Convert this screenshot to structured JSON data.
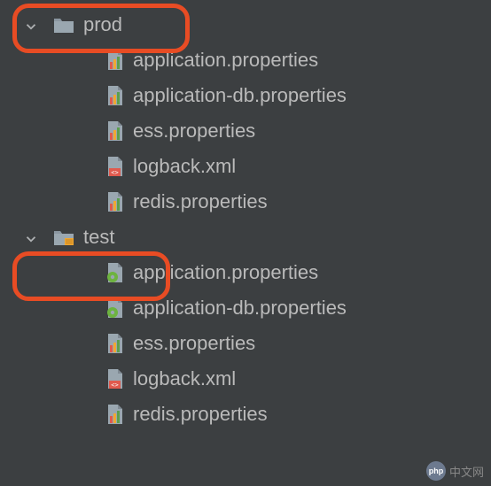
{
  "tree": {
    "folders": [
      {
        "name": "prod",
        "expanded": true,
        "highlighted": true,
        "resource_root": false,
        "children": [
          {
            "name": "application.properties",
            "icon": "properties-chart"
          },
          {
            "name": "application-db.properties",
            "icon": "properties-chart"
          },
          {
            "name": "ess.properties",
            "icon": "properties-chart"
          },
          {
            "name": "logback.xml",
            "icon": "xml"
          },
          {
            "name": "redis.properties",
            "icon": "properties-chart"
          }
        ]
      },
      {
        "name": "test",
        "expanded": true,
        "highlighted": true,
        "resource_root": true,
        "children": [
          {
            "name": "application.properties",
            "icon": "properties-spring"
          },
          {
            "name": "application-db.properties",
            "icon": "properties-spring"
          },
          {
            "name": "ess.properties",
            "icon": "properties-chart"
          },
          {
            "name": "logback.xml",
            "icon": "xml"
          },
          {
            "name": "redis.properties",
            "icon": "properties-chart"
          }
        ]
      }
    ]
  },
  "watermark": {
    "badge": "php",
    "text": "中文网"
  },
  "colors": {
    "bg": "#3c3f41",
    "text": "#bababa",
    "highlight": "#e84c24",
    "folder": "#9aa7b0",
    "resource_mark": "#f0a732"
  }
}
